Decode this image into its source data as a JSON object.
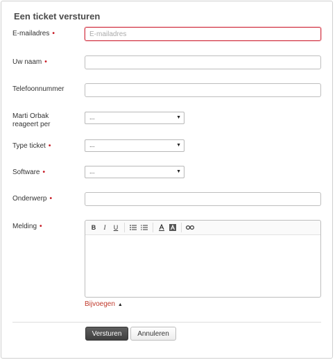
{
  "form": {
    "title": "Een ticket versturen",
    "required_marker": "•",
    "fields": {
      "email": {
        "label": "E-mailadres",
        "placeholder": "E-mailadres"
      },
      "name": {
        "label": "Uw naam"
      },
      "phone": {
        "label": "Telefoonnummer"
      },
      "respond_via": {
        "label_line1": "Marti Orbak",
        "label_line2": "reageert per",
        "value": "..."
      },
      "ticket_type": {
        "label": "Type ticket",
        "value": "..."
      },
      "software": {
        "label": "Software",
        "value": "..."
      },
      "subject": {
        "label": "Onderwerp"
      },
      "message": {
        "label": "Melding"
      }
    },
    "editor_toolbar": {
      "bold": "B",
      "italic": "I",
      "underline": "U",
      "bullet_list_icon": "bullet-list-icon",
      "numbered_list_icon": "numbered-list-icon",
      "font_color_icon": "font-color-icon",
      "background_color_icon": "background-color-icon",
      "link_icon": "link-icon"
    },
    "attach_label": "Bijvoegen",
    "submit_label": "Versturen",
    "cancel_label": "Annuleren"
  },
  "colors": {
    "required": "#c81e28",
    "error_border": "#d23a4a",
    "link": "#c0392b",
    "primary_button": "#4a4a4a"
  }
}
